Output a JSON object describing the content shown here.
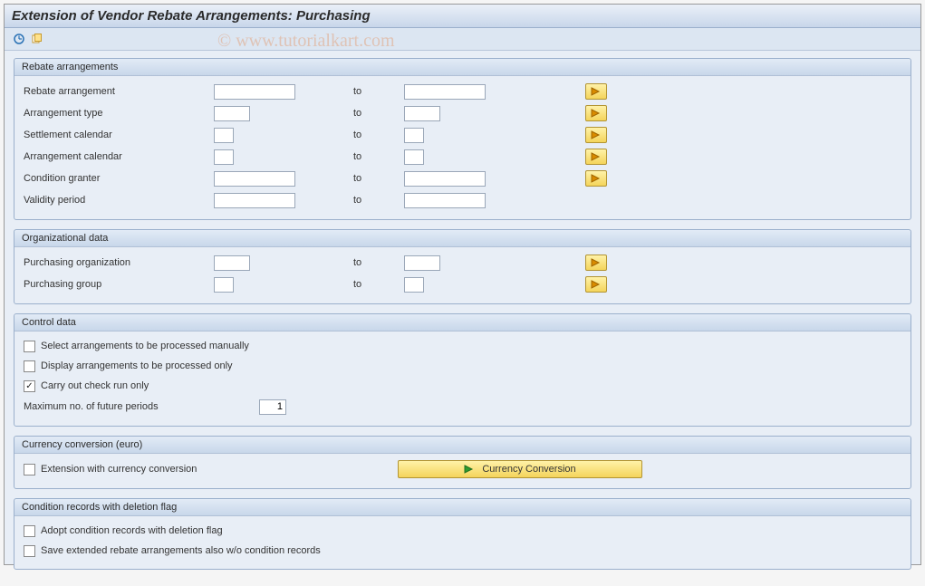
{
  "page_title": "Extension of Vendor Rebate Arrangements: Purchasing",
  "watermark": "© www.tutorialkart.com",
  "to_label": "to",
  "groups": {
    "rebate": {
      "title": "Rebate arrangements",
      "rows": {
        "rebate_arrangement": {
          "label": "Rebate arrangement",
          "from": "",
          "to": "",
          "width": "w100",
          "mult": true
        },
        "arrangement_type": {
          "label": "Arrangement type",
          "from": "",
          "to": "",
          "width": "w50",
          "mult": true
        },
        "settlement_calendar": {
          "label": "Settlement calendar",
          "from": "",
          "to": "",
          "width": "w30",
          "mult": true
        },
        "arrangement_calendar": {
          "label": "Arrangement calendar",
          "from": "",
          "to": "",
          "width": "w30",
          "mult": true
        },
        "condition_granter": {
          "label": "Condition granter",
          "from": "",
          "to": "",
          "width": "w100",
          "mult": true
        },
        "validity_period": {
          "label": "Validity period",
          "from": "",
          "to": "",
          "width": "w100",
          "mult": false
        }
      }
    },
    "org": {
      "title": "Organizational data",
      "rows": {
        "purch_org": {
          "label": "Purchasing organization",
          "from": "",
          "to": "",
          "width": "w50",
          "mult": true
        },
        "purch_group": {
          "label": "Purchasing group",
          "from": "",
          "to": "",
          "width": "w30",
          "mult": true
        }
      }
    },
    "control": {
      "title": "Control data",
      "checks": {
        "select_manual": {
          "label": "Select arrangements to be processed manually",
          "checked": false
        },
        "display_only": {
          "label": "Display arrangements to be processed only",
          "checked": false
        },
        "check_run": {
          "label": "Carry out check run only",
          "checked": true
        }
      },
      "max_periods": {
        "label": "Maximum no. of future periods",
        "value": "1"
      }
    },
    "currency": {
      "title": "Currency conversion (euro)",
      "check": {
        "label": "Extension with currency conversion",
        "checked": false
      },
      "button": "Currency Conversion"
    },
    "condrec": {
      "title": "Condition records with deletion flag",
      "checks": {
        "adopt": {
          "label": "Adopt condition records with deletion flag",
          "checked": false
        },
        "save": {
          "label": "Save extended rebate arrangements also w/o condition records",
          "checked": false
        }
      }
    }
  },
  "icons": {
    "execute": "execute-icon",
    "variant": "variant-icon",
    "arrow_right": "arrow-right-icon"
  }
}
